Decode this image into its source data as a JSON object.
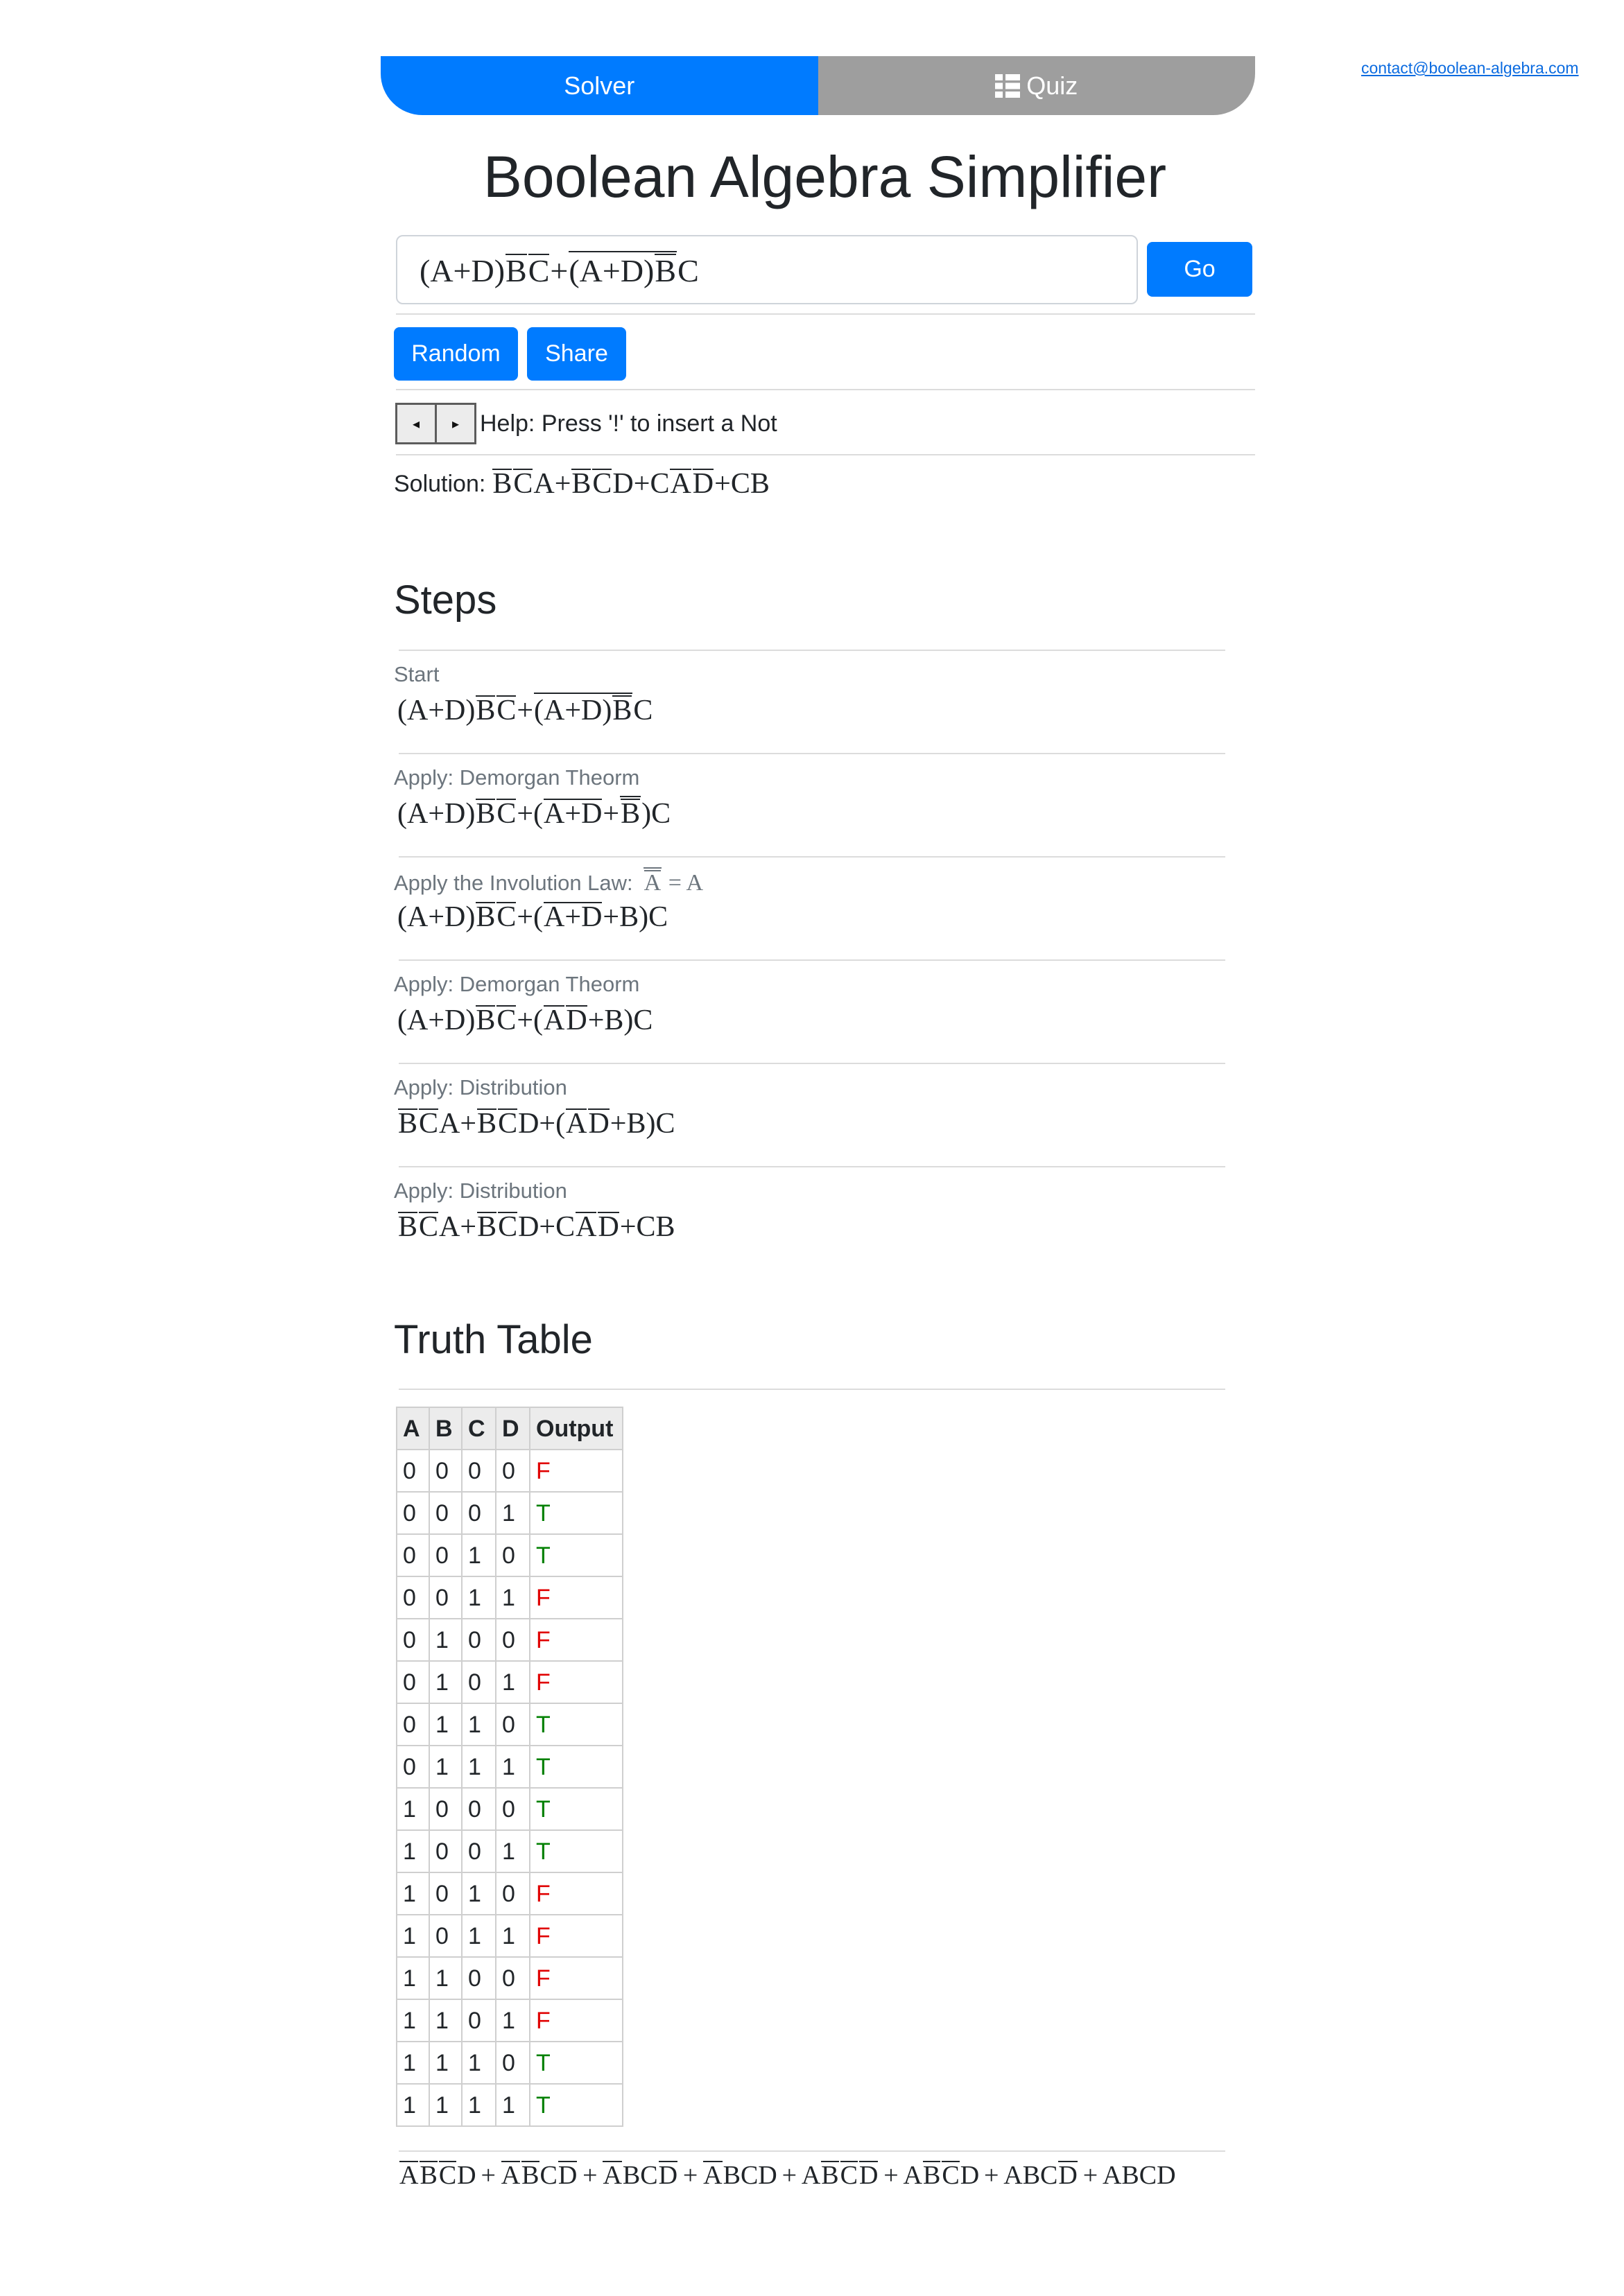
{
  "header": {
    "tabs": [
      {
        "label": "Solver",
        "active": true
      },
      {
        "label": "Quiz",
        "active": false,
        "icon": "list-icon"
      }
    ],
    "contact_email": "contact@boolean-algebra.com"
  },
  "title": "Boolean Algebra Simplifier",
  "input": {
    "expr": [
      "(A+D)",
      {
        "bar": [
          "B"
        ]
      },
      {
        "bar": [
          "C"
        ]
      },
      "+",
      {
        "bar": [
          "(A+D)",
          {
            "bar": [
              "B"
            ]
          }
        ]
      },
      "C"
    ],
    "go_label": "Go"
  },
  "actions": {
    "random_label": "Random",
    "share_label": "Share"
  },
  "nav": {
    "prev_glyph": "◂",
    "next_glyph": "▸",
    "help_text": "Help: Press '!' to insert a Not"
  },
  "solution": {
    "label": "Solution:",
    "expr": [
      {
        "bar": [
          "B"
        ]
      },
      {
        "bar": [
          "C"
        ]
      },
      "A+",
      {
        "bar": [
          "B"
        ]
      },
      {
        "bar": [
          "C"
        ]
      },
      "D+C",
      {
        "bar": [
          "A"
        ]
      },
      {
        "bar": [
          "D"
        ]
      },
      "+CB"
    ]
  },
  "steps": {
    "heading": "Steps",
    "items": [
      {
        "label": "Start",
        "expr": [
          "(A+D)",
          {
            "bar": [
              "B"
            ]
          },
          {
            "bar": [
              "C"
            ]
          },
          "+",
          {
            "bar": [
              "(A+D)",
              {
                "bar": [
                  "B"
                ]
              }
            ]
          },
          "C"
        ]
      },
      {
        "label": "Apply: Demorgan Theorm",
        "expr": [
          "(A+D)",
          {
            "bar": [
              "B"
            ]
          },
          {
            "bar": [
              "C"
            ]
          },
          "+(",
          {
            "bar": [
              "A+D"
            ]
          },
          "+",
          {
            "bar": [
              {
                "bar": [
                  "B"
                ]
              }
            ]
          },
          ")C"
        ]
      },
      {
        "label": "Apply the Involution Law:",
        "label_math": [
          {
            "bar": [
              {
                "bar": [
                  "A"
                ]
              }
            ]
          },
          " = A"
        ],
        "expr": [
          "(A+D)",
          {
            "bar": [
              "B"
            ]
          },
          {
            "bar": [
              "C"
            ]
          },
          "+(",
          {
            "bar": [
              "A+D"
            ]
          },
          "+B)C"
        ]
      },
      {
        "label": "Apply: Demorgan Theorm",
        "expr": [
          "(A+D)",
          {
            "bar": [
              "B"
            ]
          },
          {
            "bar": [
              "C"
            ]
          },
          "+(",
          {
            "bar": [
              "A"
            ]
          },
          {
            "bar": [
              "D"
            ]
          },
          "+B)C"
        ]
      },
      {
        "label": "Apply: Distribution",
        "expr": [
          {
            "bar": [
              "B"
            ]
          },
          {
            "bar": [
              "C"
            ]
          },
          "A+",
          {
            "bar": [
              "B"
            ]
          },
          {
            "bar": [
              "C"
            ]
          },
          "D+(",
          {
            "bar": [
              "A"
            ]
          },
          {
            "bar": [
              "D"
            ]
          },
          "+B)C"
        ]
      },
      {
        "label": "Apply: Distribution",
        "expr": [
          {
            "bar": [
              "B"
            ]
          },
          {
            "bar": [
              "C"
            ]
          },
          "A+",
          {
            "bar": [
              "B"
            ]
          },
          {
            "bar": [
              "C"
            ]
          },
          "D+C",
          {
            "bar": [
              "A"
            ]
          },
          {
            "bar": [
              "D"
            ]
          },
          "+CB"
        ]
      }
    ]
  },
  "truth_table": {
    "heading": "Truth Table",
    "columns": [
      "A",
      "B",
      "C",
      "D",
      "Output"
    ],
    "rows": [
      [
        "0",
        "0",
        "0",
        "0",
        "F"
      ],
      [
        "0",
        "0",
        "0",
        "1",
        "T"
      ],
      [
        "0",
        "0",
        "1",
        "0",
        "T"
      ],
      [
        "0",
        "0",
        "1",
        "1",
        "F"
      ],
      [
        "0",
        "1",
        "0",
        "0",
        "F"
      ],
      [
        "0",
        "1",
        "0",
        "1",
        "F"
      ],
      [
        "0",
        "1",
        "1",
        "0",
        "T"
      ],
      [
        "0",
        "1",
        "1",
        "1",
        "T"
      ],
      [
        "1",
        "0",
        "0",
        "0",
        "T"
      ],
      [
        "1",
        "0",
        "0",
        "1",
        "T"
      ],
      [
        "1",
        "0",
        "1",
        "0",
        "F"
      ],
      [
        "1",
        "0",
        "1",
        "1",
        "F"
      ],
      [
        "1",
        "1",
        "0",
        "0",
        "F"
      ],
      [
        "1",
        "1",
        "0",
        "1",
        "F"
      ],
      [
        "1",
        "1",
        "1",
        "0",
        "T"
      ],
      [
        "1",
        "1",
        "1",
        "1",
        "T"
      ]
    ],
    "sop_expr": [
      {
        "bar": [
          "A"
        ]
      },
      {
        "bar": [
          "B"
        ]
      },
      {
        "bar": [
          "C"
        ]
      },
      "D",
      "+",
      {
        "bar": [
          "A"
        ]
      },
      {
        "bar": [
          "B"
        ]
      },
      "C",
      {
        "bar": [
          "D"
        ]
      },
      "+",
      {
        "bar": [
          "A"
        ]
      },
      "BC",
      {
        "bar": [
          "D"
        ]
      },
      "+",
      {
        "bar": [
          "A"
        ]
      },
      "BCD",
      "+",
      "A",
      {
        "bar": [
          "B"
        ]
      },
      {
        "bar": [
          "C"
        ]
      },
      {
        "bar": [
          "D"
        ]
      },
      "+",
      "A",
      {
        "bar": [
          "B"
        ]
      },
      {
        "bar": [
          "C"
        ]
      },
      "D",
      "+",
      "ABC",
      {
        "bar": [
          "D"
        ]
      },
      "+",
      "ABCD"
    ]
  },
  "colors": {
    "primary": "#007bff",
    "tab_inactive": "#9e9e9e",
    "link": "#0b6be0",
    "label": "#6c757d",
    "true": "#008000",
    "false": "#e00000"
  }
}
